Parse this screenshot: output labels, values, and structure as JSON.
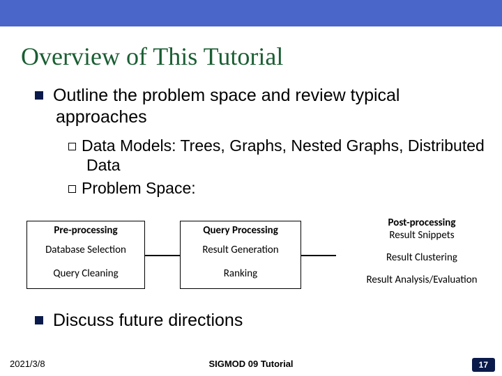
{
  "title": "Overview of This Tutorial",
  "bullets": {
    "item1": "Outline the problem space and review typical approaches",
    "sub1": "Data Models: Trees, Graphs, Nested Graphs, Distributed Data",
    "sub2": "Problem Space:",
    "item2": "Discuss future directions"
  },
  "diagram": {
    "box1": {
      "head": "Pre-processing",
      "line1": "Database Selection",
      "line2": "Query Cleaning"
    },
    "box2": {
      "head": "Query Processing",
      "line1": "Result Generation",
      "line2": "Ranking"
    },
    "post": {
      "head": "Post-processing",
      "line1": "Result Snippets",
      "line2": "Result Clustering",
      "line3": "Result Analysis/Evaluation"
    }
  },
  "footer": {
    "date": "2021/3/8",
    "center": "SIGMOD 09 Tutorial",
    "page": "17"
  }
}
